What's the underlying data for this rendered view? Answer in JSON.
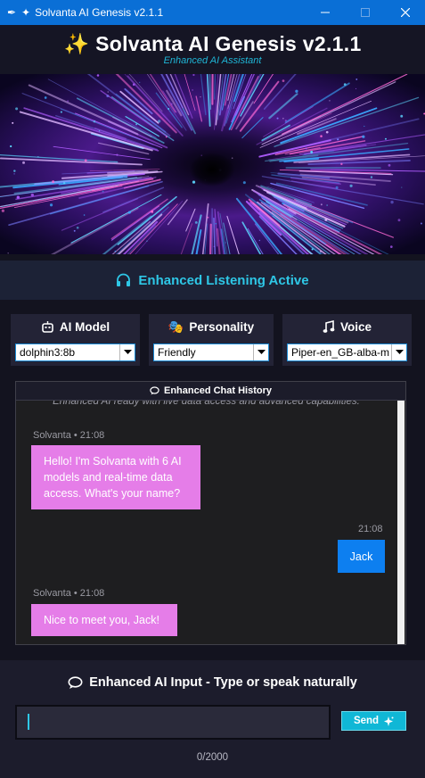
{
  "window": {
    "title": "Solvanta AI Genesis v2.1.1"
  },
  "header": {
    "title": "Solvanta AI Genesis v2.1.1",
    "subtitle": "Enhanced AI Assistant"
  },
  "status": {
    "listening_label": "Enhanced Listening Active"
  },
  "panels": {
    "model": {
      "label": "AI Model",
      "value": "dolphin3:8b",
      "icon": "robot-icon"
    },
    "personality": {
      "label": "Personality",
      "value": "Friendly",
      "icon": "theater-masks-icon"
    },
    "voice": {
      "label": "Voice",
      "value": "Piper-en_GB-alba-m",
      "icon": "music-note-icon"
    }
  },
  "chat": {
    "title": "Enhanced Chat History",
    "cut_text": "Enhanced AI ready with live data access and advanced capabilities.",
    "messages": [
      {
        "role": "ai",
        "meta": "Solvanta • 21:08",
        "text": "Hello! I'm Solvanta with 6 AI models and real-time data access. What's your name?"
      },
      {
        "role": "user",
        "meta": "21:08",
        "text": "Jack"
      },
      {
        "role": "ai",
        "meta": "Solvanta • 21:08",
        "text": "Nice to meet you, Jack!"
      }
    ]
  },
  "input": {
    "title": "Enhanced AI Input - Type or speak naturally",
    "value": "",
    "send_label": "Send",
    "counter": "0/2000"
  },
  "colors": {
    "accent": "#2ec7e6",
    "ai_bubble": "#e57de8",
    "user_bubble": "#0d7ff0",
    "titlebar": "#0a6fd6"
  }
}
